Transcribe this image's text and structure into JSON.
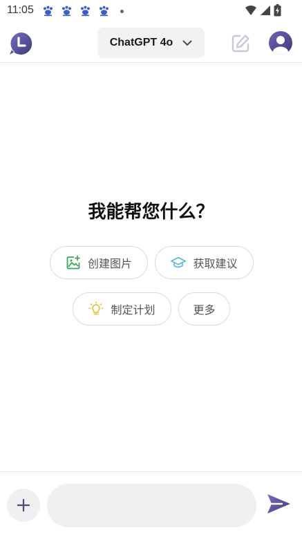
{
  "status_bar": {
    "time": "11:05",
    "notification_icons": [
      "paw-icon",
      "paw-icon",
      "paw-icon",
      "paw-icon",
      "dot-icon"
    ],
    "system_icons": [
      "wifi-icon",
      "cellular-signal-icon",
      "battery-icon"
    ]
  },
  "header": {
    "model_label": "ChatGPT 4o",
    "accent_color": "#5b5299"
  },
  "main": {
    "headline": "我能帮您什么？",
    "chips": [
      {
        "label": "创建图片",
        "icon": "image-add-icon",
        "icon_color": "#3aa55a"
      },
      {
        "label": "获取建议",
        "icon": "graduation-cap-icon",
        "icon_color": "#5bb5d6"
      },
      {
        "label": "制定计划",
        "icon": "lightbulb-icon",
        "icon_color": "#e6c232"
      },
      {
        "label": "更多",
        "icon": "",
        "icon_color": ""
      }
    ]
  },
  "composer": {
    "input_value": "",
    "input_placeholder": ""
  }
}
